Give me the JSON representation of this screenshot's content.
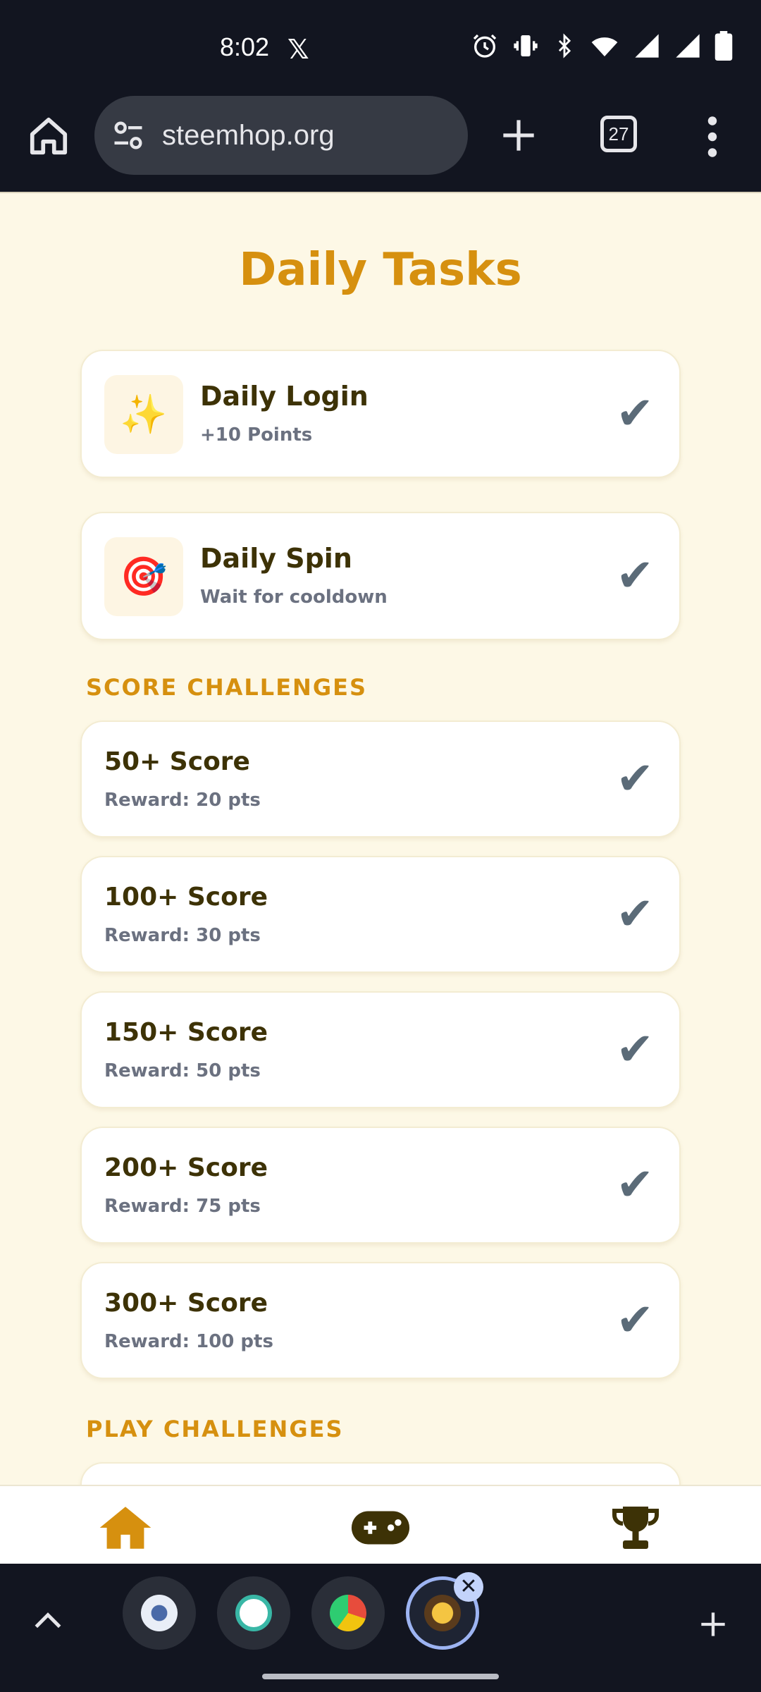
{
  "status_bar": {
    "time": "8:02",
    "x_app": "𝕏",
    "icons": [
      "alarm-icon",
      "vibrate-icon",
      "bluetooth-icon",
      "wifi-icon",
      "signal-icon",
      "signal-icon",
      "battery-icon"
    ]
  },
  "browser": {
    "url": "steemhop.org",
    "tab_count": "27"
  },
  "page": {
    "title": "Daily Tasks",
    "daily_tasks": [
      {
        "icon": "✨",
        "icon_name": "sparkles-icon",
        "title": "Daily Login",
        "subtitle": "+10 Points",
        "check": "✔"
      },
      {
        "icon": "🎯",
        "icon_name": "target-icon",
        "title": "Daily Spin",
        "subtitle": "Wait for cooldown",
        "check": "✔"
      }
    ],
    "score_heading": "SCORE CHALLENGES",
    "score_challenges": [
      {
        "title": "50+ Score",
        "reward": "Reward: 20 pts",
        "check": "✔"
      },
      {
        "title": "100+ Score",
        "reward": "Reward: 30 pts",
        "check": "✔"
      },
      {
        "title": "150+ Score",
        "reward": "Reward: 50 pts",
        "check": "✔"
      },
      {
        "title": "200+ Score",
        "reward": "Reward: 75 pts",
        "check": "✔"
      },
      {
        "title": "300+ Score",
        "reward": "Reward: 100 pts",
        "check": "✔"
      }
    ],
    "play_heading": "PLAY CHALLENGES"
  },
  "bottom_nav": {
    "items": [
      "home-icon",
      "gamepad-icon",
      "trophy-icon"
    ],
    "colors": {
      "home": "#d6900f",
      "game": "#3d3206",
      "trophy": "#3d3206"
    }
  },
  "tab_strip": {
    "close_label": "✕"
  },
  "colors": {
    "accent": "#d6900f",
    "title_text": "#3d3206",
    "sub_text": "#6b7180",
    "page_bg": "#fdf8e6"
  }
}
